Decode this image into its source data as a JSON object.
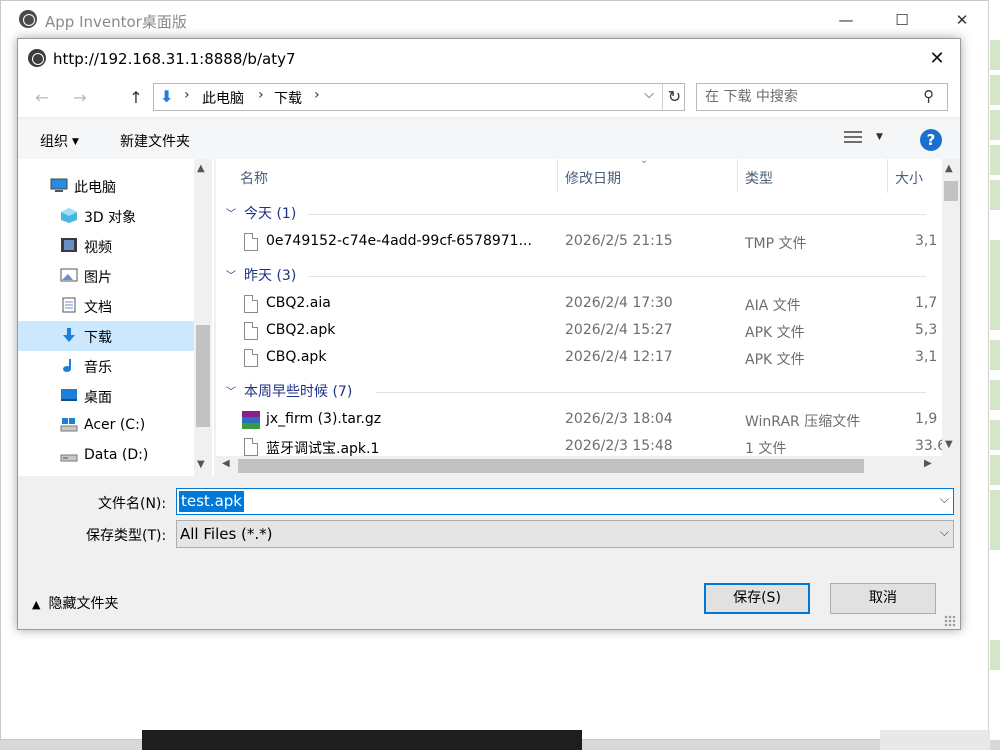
{
  "app": {
    "title": "App Inventor桌面版",
    "controls": {
      "minimize": "—",
      "maximize": "☐",
      "close": "✕"
    }
  },
  "dialog": {
    "title": "http://192.168.31.1:8888/b/aty7",
    "close": "✕"
  },
  "address": {
    "back": "←",
    "forward": "→",
    "up": "↑",
    "breadcrumbs": [
      "此电脑",
      "下载"
    ],
    "separator": "›",
    "dropdown": "⌵",
    "refresh": "↻"
  },
  "search": {
    "placeholder": "在 下载 中搜索"
  },
  "toolbar": {
    "organize": "组织",
    "new_folder": "新建文件夹",
    "help": "?"
  },
  "nav": {
    "items": [
      {
        "label": "此电脑",
        "icon": "computer-icon"
      },
      {
        "label": "3D 对象",
        "icon": "cube-icon"
      },
      {
        "label": "视频",
        "icon": "video-icon"
      },
      {
        "label": "图片",
        "icon": "picture-icon"
      },
      {
        "label": "文档",
        "icon": "document-icon"
      },
      {
        "label": "下载",
        "icon": "download-icon",
        "selected": true
      },
      {
        "label": "音乐",
        "icon": "music-icon"
      },
      {
        "label": "桌面",
        "icon": "desktop-icon"
      },
      {
        "label": "Acer (C:)",
        "icon": "drive-icon"
      },
      {
        "label": "Data (D:)",
        "icon": "drive-icon"
      }
    ]
  },
  "columns": {
    "name": "名称",
    "date": "修改日期",
    "type": "类型",
    "size": "大小"
  },
  "groups": [
    {
      "label": "今天 (1)",
      "files": [
        {
          "name": "0e749152-c74e-4add-99cf-6578971...",
          "date": "2026/2/5 21:15",
          "type": "TMP 文件",
          "size": "3,1",
          "icon": "file-icon"
        }
      ]
    },
    {
      "label": "昨天 (3)",
      "files": [
        {
          "name": "CBQ2.aia",
          "date": "2026/2/4 17:30",
          "type": "AIA 文件",
          "size": "1,7",
          "icon": "file-icon"
        },
        {
          "name": "CBQ2.apk",
          "date": "2026/2/4 15:27",
          "type": "APK 文件",
          "size": "5,3",
          "icon": "file-icon"
        },
        {
          "name": "CBQ.apk",
          "date": "2026/2/4 12:17",
          "type": "APK 文件",
          "size": "3,1",
          "icon": "file-icon"
        }
      ]
    },
    {
      "label": "本周早些时候 (7)",
      "files": [
        {
          "name": "jx_firm (3).tar.gz",
          "date": "2026/2/3 18:04",
          "type": "WinRAR 压缩文件",
          "size": "1,9",
          "icon": "winrar-icon"
        },
        {
          "name": "蓝牙调试宝.apk.1",
          "date": "2026/2/3 15:48",
          "type": "1 文件",
          "size": "33.6",
          "icon": "file-icon"
        }
      ]
    }
  ],
  "form": {
    "filename_label": "文件名(N):",
    "filename_value": "test.apk",
    "filetype_label": "保存类型(T):",
    "filetype_value": "All Files (*.*)",
    "hide_folders": "隐藏文件夹",
    "save": "保存(S)",
    "cancel": "取消"
  }
}
